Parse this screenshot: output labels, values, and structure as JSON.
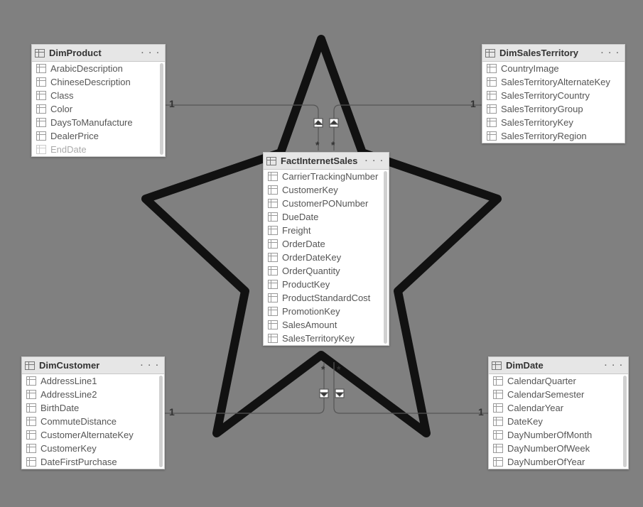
{
  "tables": {
    "dimProduct": {
      "title": "DimProduct",
      "fields": [
        "ArabicDescription",
        "ChineseDescription",
        "Class",
        "Color",
        "DaysToManufacture",
        "DealerPrice",
        "EndDate"
      ]
    },
    "dimSalesTerritory": {
      "title": "DimSalesTerritory",
      "fields": [
        "CountryImage",
        "SalesTerritoryAlternateKey",
        "SalesTerritoryCountry",
        "SalesTerritoryGroup",
        "SalesTerritoryKey",
        "SalesTerritoryRegion"
      ]
    },
    "factInternetSales": {
      "title": "FactInternetSales",
      "fields": [
        "CarrierTrackingNumber",
        "CustomerKey",
        "CustomerPONumber",
        "DueDate",
        "Freight",
        "OrderDate",
        "OrderDateKey",
        "OrderQuantity",
        "ProductKey",
        "ProductStandardCost",
        "PromotionKey",
        "SalesAmount",
        "SalesTerritoryKey"
      ]
    },
    "dimCustomer": {
      "title": "DimCustomer",
      "fields": [
        "AddressLine1",
        "AddressLine2",
        "BirthDate",
        "CommuteDistance",
        "CustomerAlternateKey",
        "CustomerKey",
        "DateFirstPurchase"
      ]
    },
    "dimDate": {
      "title": "DimDate",
      "fields": [
        "CalendarQuarter",
        "CalendarSemester",
        "CalendarYear",
        "DateKey",
        "DayNumberOfMonth",
        "DayNumberOfWeek",
        "DayNumberOfYear"
      ]
    }
  },
  "relationships": {
    "cardinalityOne": "1",
    "cardinalityMany": "*"
  },
  "menuDots": "· · ·"
}
